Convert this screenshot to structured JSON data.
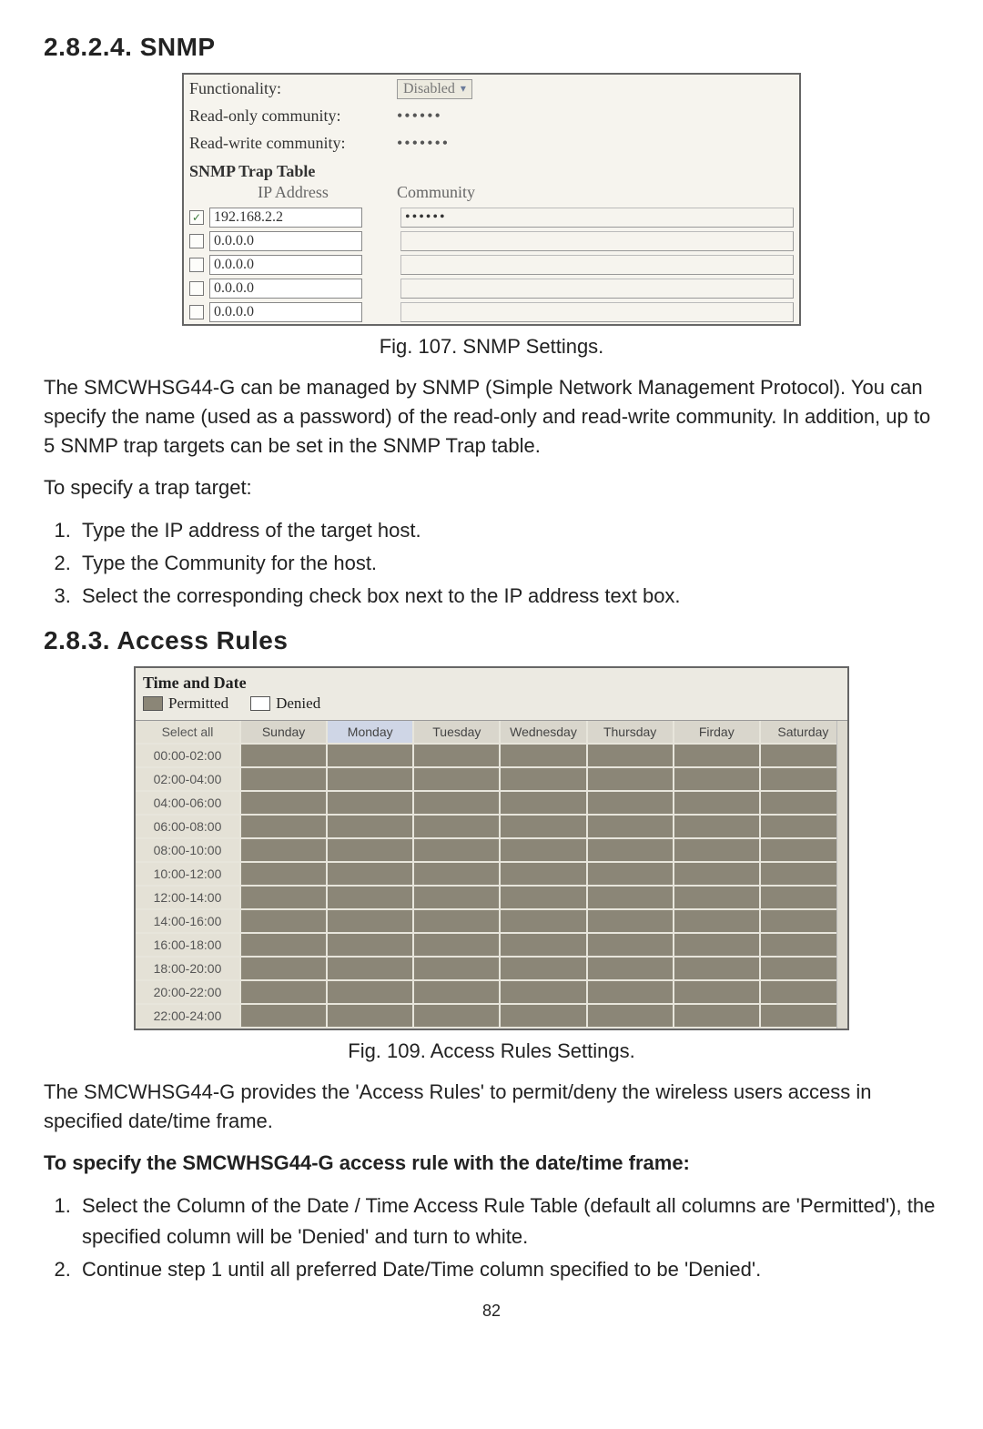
{
  "section1": {
    "number": "2.8.2.4.",
    "title": "SNMP"
  },
  "snmp": {
    "labels": {
      "functionality": "Functionality:",
      "readonly": "Read-only community:",
      "readwrite": "Read-write community:",
      "trapTable": "SNMP Trap Table",
      "colIP": "IP Address",
      "colCommunity": "Community"
    },
    "functionality_value": "Disabled",
    "readonly_value": "••••••",
    "readwrite_value": "•••••••",
    "rows": [
      {
        "checked": true,
        "ip": "192.168.2.2",
        "community": "••••••"
      },
      {
        "checked": false,
        "ip": "0.0.0.0",
        "community": ""
      },
      {
        "checked": false,
        "ip": "0.0.0.0",
        "community": ""
      },
      {
        "checked": false,
        "ip": "0.0.0.0",
        "community": ""
      },
      {
        "checked": false,
        "ip": "0.0.0.0",
        "community": ""
      }
    ]
  },
  "fig107": "Fig. 107. SNMP Settings.",
  "para1": "The SMCWHSG44-G can be managed by SNMP (Simple Network Management Protocol). You can specify the name (used as a password) of the read-only and read-write community. In addition, up to 5 SNMP trap targets can be set in the SNMP Trap table.",
  "para2": "To specify a trap target:",
  "steps1": [
    "Type the IP address of the target host.",
    "Type the Community for the host.",
    "Select the corresponding check box next to the IP address text box."
  ],
  "section2": {
    "number": "2.8.3.",
    "title": "Access Rules"
  },
  "accessRules": {
    "title": "Time and Date",
    "legend": {
      "permitted": "Permitted",
      "denied": "Denied"
    },
    "selectAll": "Select all",
    "days": [
      "Sunday",
      "Monday",
      "Tuesday",
      "Wednesday",
      "Thursday",
      "Firday",
      "Saturday"
    ],
    "highlightedDay": "Monday",
    "timeslots": [
      "00:00-02:00",
      "02:00-04:00",
      "04:00-06:00",
      "06:00-08:00",
      "08:00-10:00",
      "10:00-12:00",
      "12:00-14:00",
      "14:00-16:00",
      "16:00-18:00",
      "18:00-20:00",
      "20:00-22:00",
      "22:00-24:00"
    ]
  },
  "fig109": "Fig. 109. Access Rules Settings.",
  "para3": "The SMCWHSG44-G provides the 'Access Rules' to permit/deny the wireless users access in specified date/time frame.",
  "para4": "To specify the SMCWHSG44-G access rule with the date/time frame:",
  "steps2": [
    "Select the Column of the Date / Time Access Rule Table (default all columns are 'Permitted'), the specified column will be 'Denied' and turn to white.",
    "Continue step 1 until all preferred Date/Time column specified to be 'Denied'."
  ],
  "pageNumber": "82"
}
